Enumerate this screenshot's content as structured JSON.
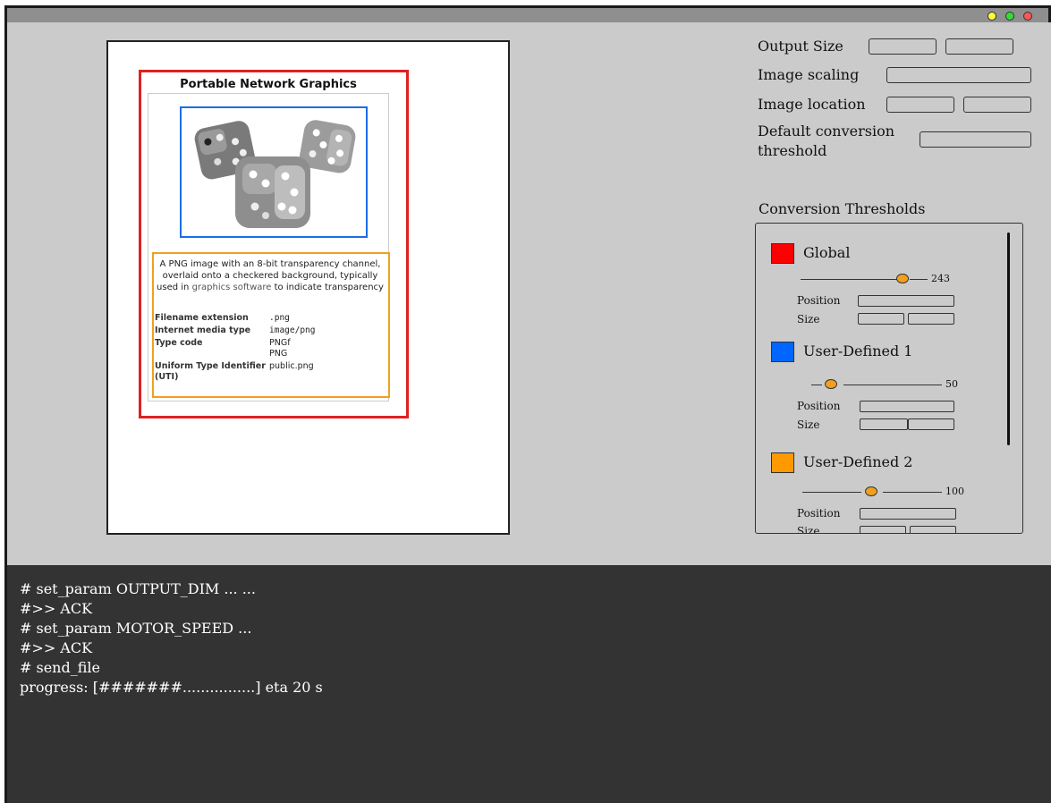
{
  "window": {
    "controls": [
      "yellow-dot",
      "green-dot",
      "red-dot"
    ]
  },
  "preview": {
    "infobox": {
      "title": "Portable Network Graphics",
      "image_alt": "dice-image",
      "caption_pre": "A PNG image with an 8-bit transparency channel, overlaid onto a checkered background, typically used in ",
      "caption_link": "graphics software",
      "caption_post": " to indicate transparency",
      "rows": [
        {
          "key": "Filename extension",
          "value": ".png"
        },
        {
          "key": "Internet media type",
          "value": "image/png"
        },
        {
          "key": "Type code",
          "value": "PNGf",
          "value2": "PNG"
        },
        {
          "key": "Uniform Type Identifier (UTI)",
          "value": "public.png"
        }
      ]
    }
  },
  "settings": {
    "output_size_label": "Output Size",
    "image_scaling_label": "Image scaling",
    "image_location_label": "Image location",
    "default_threshold_label": "Default conversion threshold",
    "thresholds_heading": "Conversion Thresholds",
    "thresholds": [
      {
        "name": "Global",
        "color": "#ff0000",
        "value": "243",
        "position_label": "Position",
        "size_label": "Size"
      },
      {
        "name": "User-Defined 1",
        "color": "#0066ff",
        "value": "50",
        "position_label": "Position",
        "size_label": "Size"
      },
      {
        "name": "User-Defined 2",
        "color": "#ff9900",
        "value": "100",
        "position_label": "Position",
        "size_label": "Size"
      }
    ]
  },
  "console": {
    "lines": [
      "# set_param OUTPUT_DIM ... ...",
      "#>> ACK",
      "# set_param MOTOR_SPEED ...",
      "#>> ACK",
      "# send_file",
      "progress: [#######................] eta 20 s"
    ],
    "progress_fraction": 0.3
  }
}
